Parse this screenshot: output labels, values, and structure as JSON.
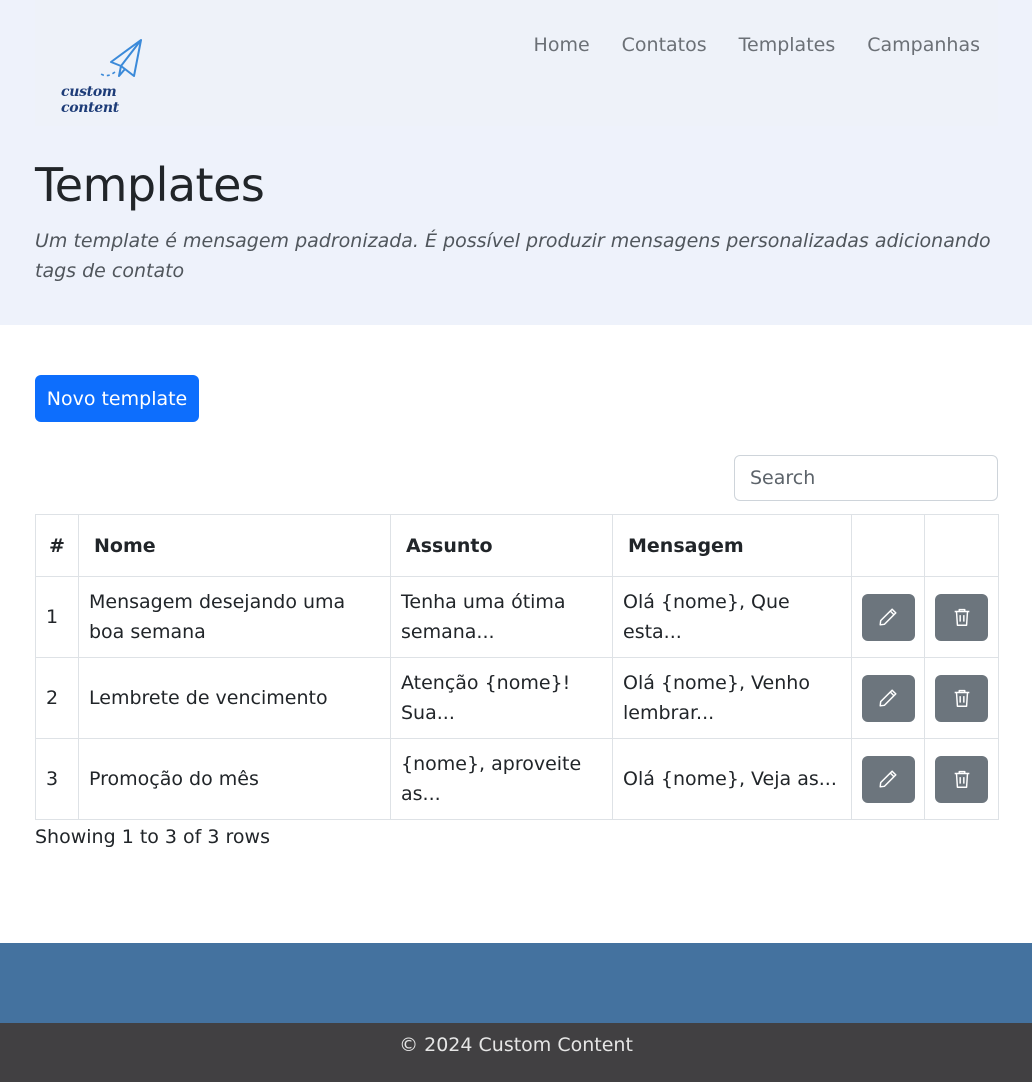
{
  "brand": {
    "logo_text": "custom content",
    "logo_icon": "paper-plane-icon"
  },
  "nav": [
    {
      "label": "Home"
    },
    {
      "label": "Contatos"
    },
    {
      "label": "Templates"
    },
    {
      "label": "Campanhas"
    }
  ],
  "page": {
    "title": "Templates",
    "subtitle": "Um template é mensagem padronizada. É possível produzir mensagens personalizadas adicionando tags de contato"
  },
  "actions": {
    "new_label": "Novo template"
  },
  "search": {
    "placeholder": "Search"
  },
  "table": {
    "headers": {
      "num": "#",
      "name": "Nome",
      "subject": "Assunto",
      "message": "Mensagem"
    },
    "rows": [
      {
        "num": "1",
        "name": "Mensagem desejando uma boa semana",
        "subject": "Tenha uma ótima semana...",
        "message": "Olá {nome}, Que esta..."
      },
      {
        "num": "2",
        "name": "Lembrete de vencimento",
        "subject": "Atenção {nome}! Sua...",
        "message": "Olá {nome}, Venho lembrar..."
      },
      {
        "num": "3",
        "name": "Promoção do mês",
        "subject": "{nome}, aproveite as...",
        "message": "Olá {nome}, Veja as..."
      }
    ],
    "edit_icon": "pencil-icon",
    "delete_icon": "trash-icon"
  },
  "pagination": {
    "summary": "Showing 1 to 3 of 3 rows"
  },
  "footer": {
    "copyright": "© 2024 Custom Content"
  },
  "colors": {
    "primary": "#0d6efd",
    "secondary": "#6c757d",
    "footer_blue": "#44729f",
    "footer_dark": "#414042",
    "hero_bg": "#eef2fb"
  }
}
